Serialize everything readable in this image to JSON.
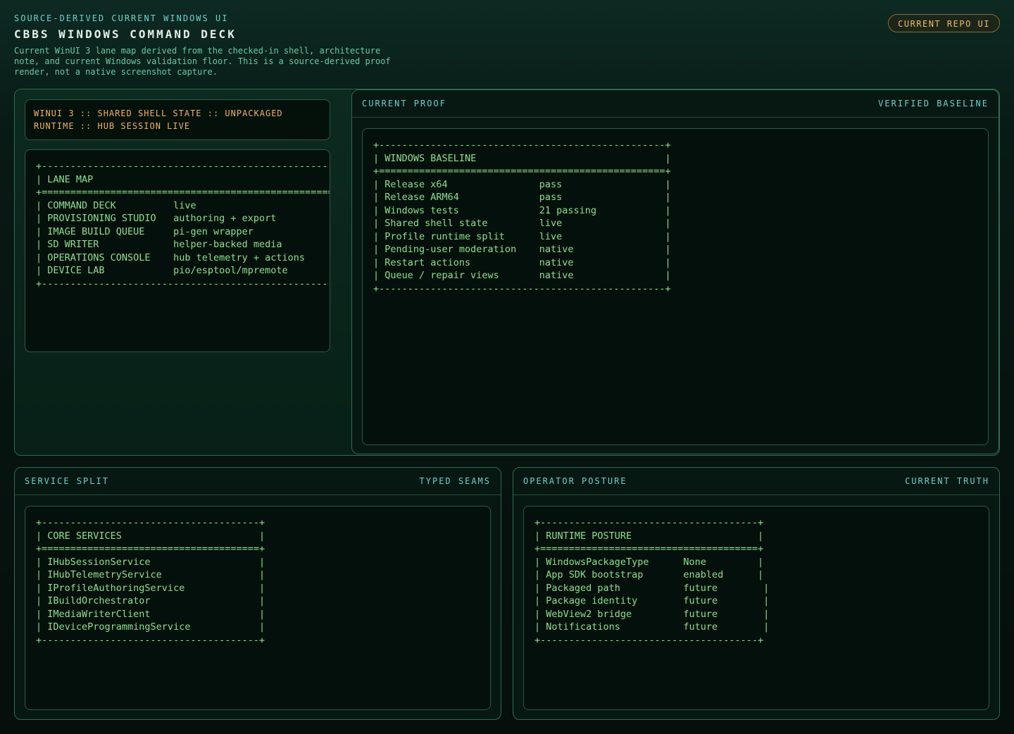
{
  "header": {
    "kicker": "SOURCE-DERIVED CURRENT WINDOWS UI",
    "title": "CBBS WINDOWS COMMAND DECK",
    "description": "Current WinUI 3 lane map derived from the checked-in shell, architecture note, and current Windows validation floor. This is a source-derived proof render, not a native screenshot capture.",
    "badge": "CURRENT REPO UI"
  },
  "status": {
    "line1": "WINUI 3 :: SHARED SHELL STATE :: UNPACKAGED",
    "line2": "RUNTIME :: HUB SESSION LIVE"
  },
  "lane_map": {
    "ascii": "+------------------------------------------------------\n| LANE MAP\n+======================================================\n| COMMAND DECK          live\n| PROVISIONING STUDIO   authoring + export\n| IMAGE BUILD QUEUE     pi-gen wrapper\n| SD WRITER             helper-backed media\n| OPERATIONS CONSOLE    hub telemetry + actions\n| DEVICE LAB            pio/esptool/mpremote\n+------------------------------------------------------"
  },
  "current_proof": {
    "title": "CURRENT PROOF",
    "tag": "VERIFIED BASELINE",
    "ascii": "+--------------------------------------------------+\n| WINDOWS BASELINE                                 |\n+==================================================+\n| Release x64                pass                  |\n| Release ARM64              pass                  |\n| Windows tests              21 passing            |\n| Shared shell state         live                  |\n| Profile runtime split      live                  |\n| Pending-user moderation    native                |\n| Restart actions            native                |\n| Queue / repair views       native                |\n+--------------------------------------------------+"
  },
  "service_split": {
    "title": "SERVICE SPLIT",
    "tag": "TYPED SEAMS",
    "ascii": "+--------------------------------------+\n| CORE SERVICES                        |\n+======================================+\n| IHubSessionService                   |\n| IHubTelemetryService                 |\n| IProfileAuthoringService             |\n| IBuildOrchestrator                   |\n| IMediaWriterClient                   |\n| IDeviceProgrammingService            |\n+--------------------------------------+"
  },
  "operator_posture": {
    "title": "OPERATOR POSTURE",
    "tag": "CURRENT TRUTH",
    "ascii": "+--------------------------------------+\n| RUNTIME POSTURE                      |\n+======================================+\n| WindowsPackageType      None         |\n| App SDK bootstrap       enabled      |\n| Packaged path           future        |\n| Package identity        future        |\n| WebView2 bridge         future        |\n| Notifications           future        |\n+--------------------------------------+"
  }
}
